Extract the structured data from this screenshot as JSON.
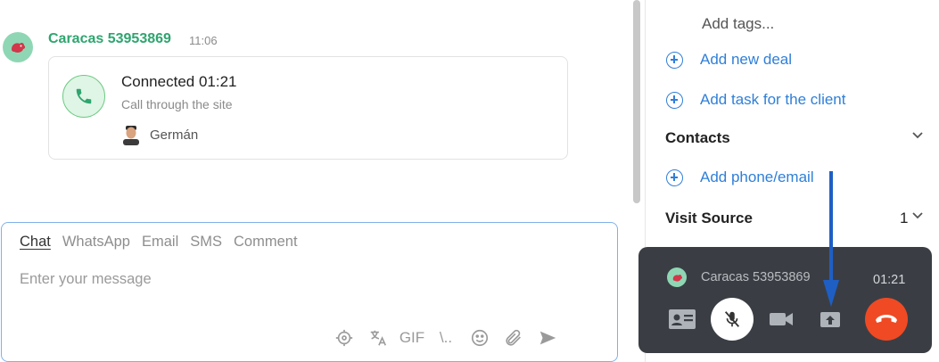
{
  "chat": {
    "sender": "Caracas 53953869",
    "time": "11:06",
    "call_card": {
      "title": "Connected 01:21",
      "subtitle": "Call through the site",
      "agent": "Germán"
    }
  },
  "composer": {
    "tabs": [
      "Chat",
      "WhatsApp",
      "Email",
      "SMS",
      "Comment"
    ],
    "active_tab": "Chat",
    "placeholder": "Enter your message",
    "value": "",
    "tools": [
      "target-icon",
      "translate-icon",
      "gif-icon",
      "template-icon",
      "emoji-icon",
      "attach-icon",
      "send-icon"
    ],
    "gif_label": "GIF",
    "template_label": "\\.."
  },
  "panel": {
    "tags_placeholder": "Add tags...",
    "add_deal": "Add new deal",
    "add_task": "Add task for the client",
    "contacts_title": "Contacts",
    "add_phone": "Add phone/email",
    "visit_source_title": "Visit Source",
    "visit_source_count": "1"
  },
  "call_widget": {
    "name": "Caracas 53953869",
    "duration": "01:21",
    "buttons": [
      "contact-card-icon",
      "mic-off-icon",
      "video-icon",
      "transfer-icon",
      "hang-up-icon"
    ]
  },
  "colors": {
    "brand_green": "#2fa56f",
    "link_blue": "#2f7fd8",
    "widget_bg": "#3a3e44",
    "hangup_red": "#ef4a24",
    "annotation_arrow": "#1f5fc4"
  }
}
